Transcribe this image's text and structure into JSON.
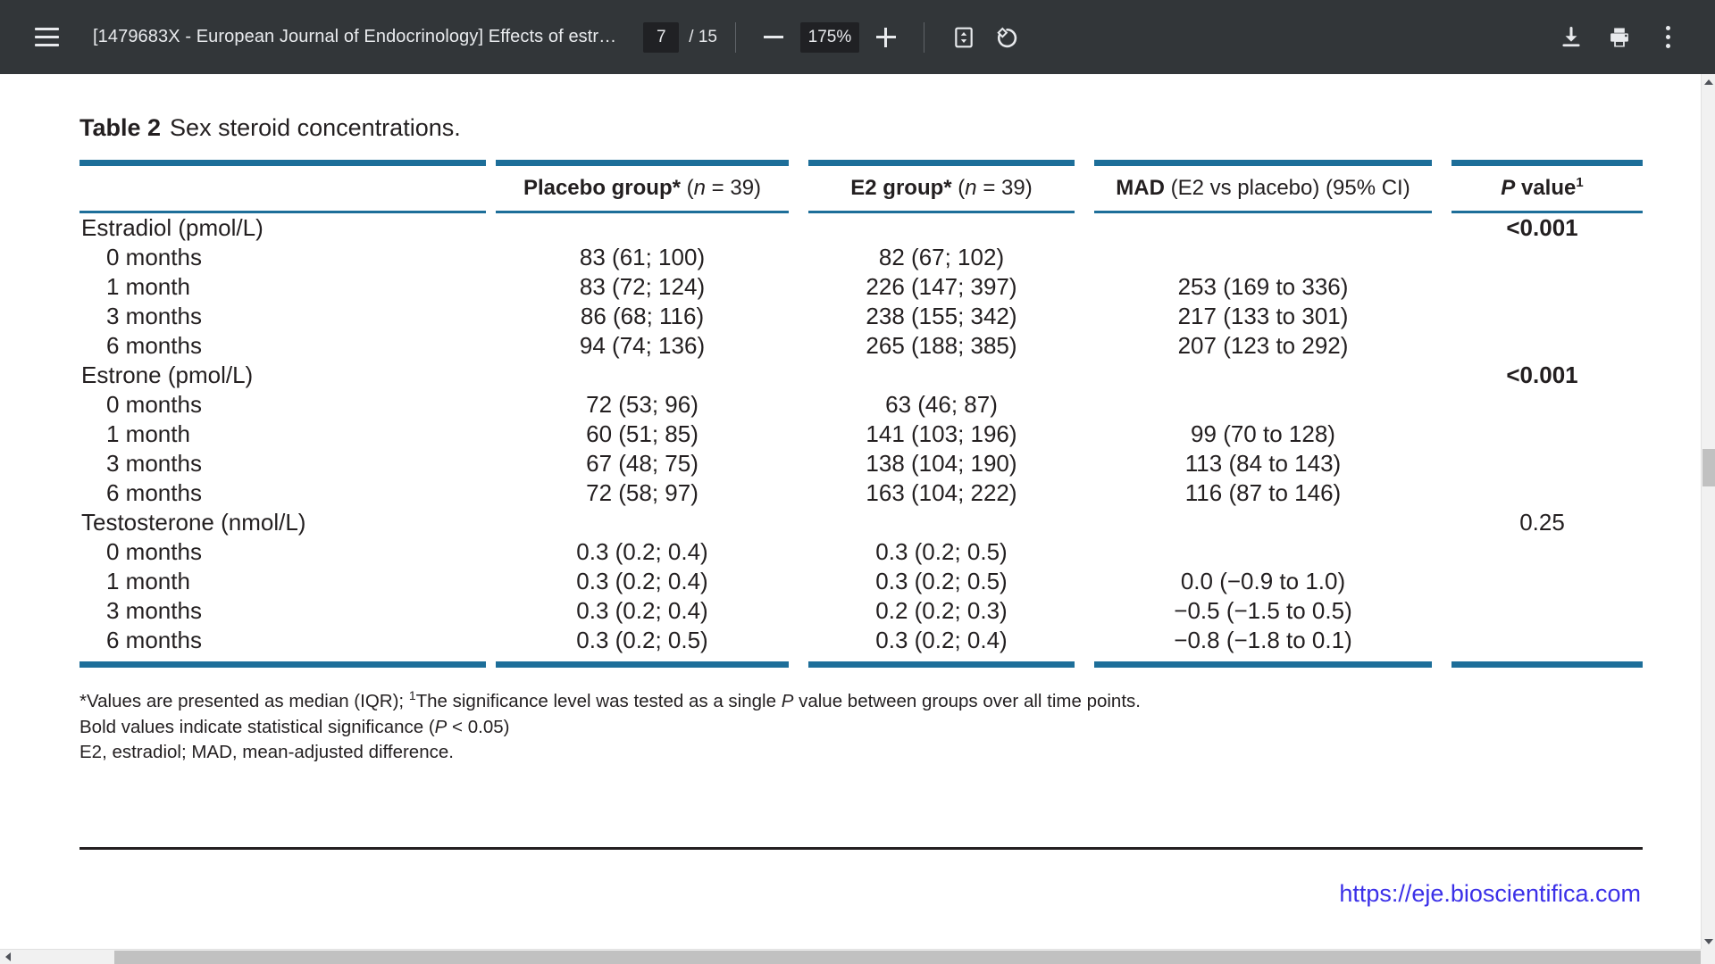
{
  "toolbar": {
    "menu_icon": "hamburger-menu-icon",
    "document_title": "[1479683X - European Journal of Endocrinology] Effects of estr…",
    "page_current": "7",
    "page_total": "/ 15",
    "zoom_out_icon": "minus-icon",
    "zoom_level": "175%",
    "zoom_in_icon": "plus-icon",
    "fit_page_icon": "fit-to-page-icon",
    "rotate_icon": "rotate-counterclockwise-icon",
    "download_icon": "download-icon",
    "print_icon": "print-icon",
    "more_icon": "kebab-menu-icon",
    "bg_color": "#323639"
  },
  "document": {
    "caption_label": "Table 2",
    "caption_text": "Sex steroid concentrations.",
    "rule_color": "#1d6e99",
    "url": "https://eje.bioscientifica.com",
    "url_color": "#3b30e8",
    "headers": {
      "col0": "",
      "placebo_bold": "Placebo group*",
      "placebo_n_pre": " (",
      "placebo_n_italic": "n",
      "placebo_n_post": " = 39)",
      "e2_bold": "E2 group*",
      "e2_n_pre": " (",
      "e2_n_italic": "n",
      "e2_n_post": " = 39)",
      "mad_bold": "MAD",
      "mad_rest": " (E2 vs placebo) (95% CI)",
      "p_italic": "P",
      "p_rest": " value",
      "p_sup": "1"
    },
    "sections": [
      {
        "name": "Estradiol (pmol/L)",
        "p_value": "<0.001",
        "p_bold": true,
        "rows": [
          {
            "time": "0 months",
            "placebo": "83 (61; 100)",
            "e2": "82 (67; 102)",
            "mad": ""
          },
          {
            "time": "1 month",
            "placebo": "83 (72; 124)",
            "e2": "226 (147; 397)",
            "mad": "253 (169 to 336)"
          },
          {
            "time": "3 months",
            "placebo": "86 (68; 116)",
            "e2": "238 (155; 342)",
            "mad": "217 (133 to 301)"
          },
          {
            "time": "6 months",
            "placebo": "94 (74; 136)",
            "e2": "265 (188; 385)",
            "mad": "207 (123 to 292)"
          }
        ]
      },
      {
        "name": "Estrone (pmol/L)",
        "p_value": "<0.001",
        "p_bold": true,
        "rows": [
          {
            "time": "0 months",
            "placebo": "72 (53; 96)",
            "e2": "63 (46; 87)",
            "mad": ""
          },
          {
            "time": "1 month",
            "placebo": "60 (51; 85)",
            "e2": "141 (103; 196)",
            "mad": "99 (70 to 128)"
          },
          {
            "time": "3 months",
            "placebo": "67 (48; 75)",
            "e2": "138 (104; 190)",
            "mad": "113 (84 to 143)"
          },
          {
            "time": "6 months",
            "placebo": "72 (58; 97)",
            "e2": "163 (104; 222)",
            "mad": "116 (87 to 146)"
          }
        ]
      },
      {
        "name": "Testosterone (nmol/L)",
        "p_value": "0.25",
        "p_bold": false,
        "rows": [
          {
            "time": "0 months",
            "placebo": "0.3 (0.2; 0.4)",
            "e2": "0.3 (0.2; 0.5)",
            "mad": ""
          },
          {
            "time": "1 month",
            "placebo": "0.3 (0.2; 0.4)",
            "e2": "0.3 (0.2; 0.5)",
            "mad": "0.0 (−0.9 to 1.0)"
          },
          {
            "time": "3 months",
            "placebo": "0.3 (0.2; 0.4)",
            "e2": "0.2 (0.2; 0.3)",
            "mad": "−0.5 (−1.5 to 0.5)"
          },
          {
            "time": "6 months",
            "placebo": "0.3 (0.2; 0.5)",
            "e2": "0.3 (0.2; 0.4)",
            "mad": "−0.8 (−1.8 to 0.1)"
          }
        ]
      }
    ],
    "footnotes": {
      "line1_a": "*Values are presented as median (IQR); ",
      "line1_sup": "1",
      "line1_b": "The significance level was tested as a single ",
      "line1_italic": "P",
      "line1_c": " value between groups over all time points.",
      "line2_a": "Bold values indicate statistical significance (",
      "line2_italic": "P",
      "line2_b": " < 0.05)",
      "line3": "E2, estradiol; MAD, mean-adjusted difference."
    }
  },
  "scrollbars": {
    "vertical_up_icon": "scroll-up-arrow-icon",
    "vertical_down_icon": "scroll-down-arrow-icon",
    "horizontal_left_icon": "scroll-left-arrow-icon"
  }
}
